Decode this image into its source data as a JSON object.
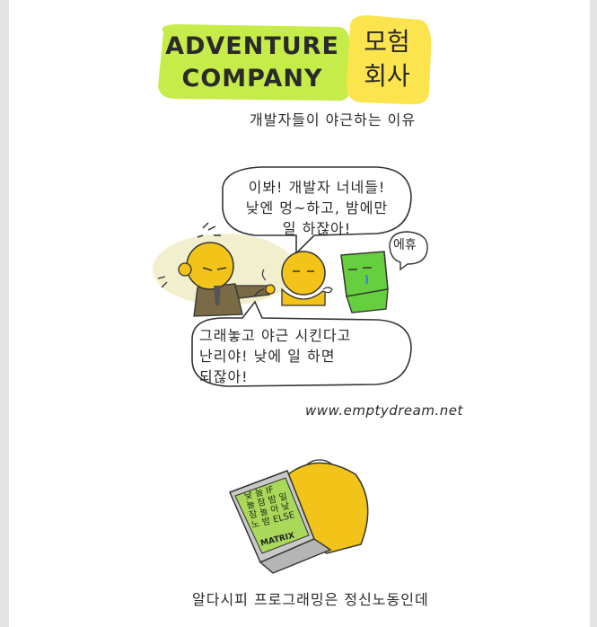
{
  "title": {
    "english_line1": "ADVENTURE",
    "english_line2": "COMPANY",
    "korean_line1": "모험",
    "korean_line2": "회사"
  },
  "subtitle": "개발자들이 야근하는 이유",
  "panel1": {
    "speech_top_line1": "이봐! 개발자 너네들!",
    "speech_top_line2": "낮엔 멍~하고, 밤에만",
    "speech_top_line3": "일 하잖아!",
    "sigh": "에휴",
    "speech_bottom_line1": "그래놓고 야근 시킨다고",
    "speech_bottom_line2": "난리야! 낮에 일 하면",
    "speech_bottom_line3": "되잖아!",
    "url": "www.emptydream.net"
  },
  "panel2": {
    "screen_line1": "낮 늘 IF",
    "screen_line2": "놀 잠 밤 일",
    "screen_line3": "잠 놀 아 낮",
    "screen_line4": "노 밤 ELSE",
    "laptop_label": "MATRIX",
    "caption": "알다시피 프로그래밍은 정신노동인데"
  },
  "colors": {
    "lime": "#c6ec4a",
    "yellow": "#fbe44e",
    "skin": "#f2c419",
    "green_character": "#66cf3d",
    "screen": "#a9d85b",
    "ink": "#2a2a2a"
  }
}
